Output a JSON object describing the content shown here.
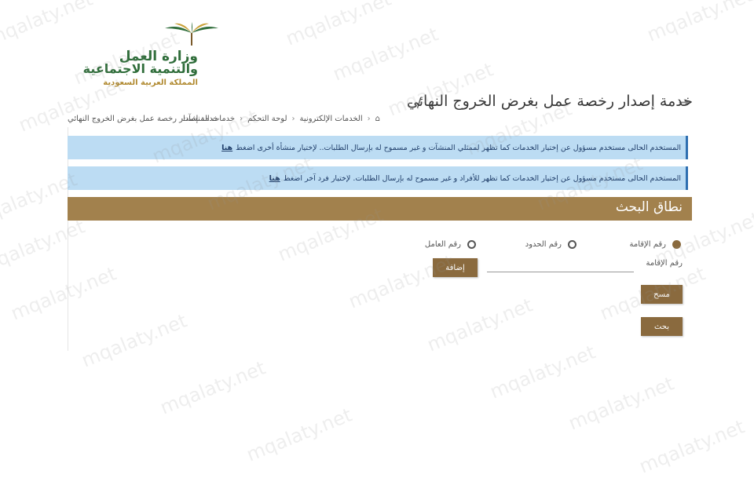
{
  "logo": {
    "line1": "وزارة العمل",
    "line2": "والتنمية الاجتماعية",
    "line3": "المملكة العربية السعودية"
  },
  "page": {
    "title": "خدمة إصدار رخصة عمل بغرض الخروج النهائي",
    "title_suffix": "/  -"
  },
  "breadcrumb": {
    "items": [
      "الخدمات الإلكترونية",
      "لوحة التحكم",
      "خدمات المنشآت",
      "خدمة إصدار رخصة عمل بغرض الخروج النهائي"
    ]
  },
  "alerts": [
    {
      "text": "المستخدم الحالى مستخدم مسؤول عن إختيار الخدمات كما تظهر لممثلي المنشآت و غير مسموح له بإرسال الطلبات.. لإختيار منشأة أخرى اضغط",
      "link": "هنا"
    },
    {
      "text": "المستخدم الحالى مستخدم مسؤول عن إختيار الخدمات كما تظهر للأفراد و غير مسموح له بإرسال الطلبات. لإختيار فرد آخر اضغط",
      "link": "هنا"
    }
  ],
  "search_section": {
    "title": "نطاق البحث",
    "options": [
      {
        "label": "رقم الإقامة",
        "selected": true
      },
      {
        "label": "رقم الحدود",
        "selected": false
      },
      {
        "label": "رقم العامل",
        "selected": false
      }
    ],
    "field_label": "رقم الإقامة",
    "field_value": "",
    "add_button": "إضافة",
    "clear_button": "مسح",
    "search_button": "بحث"
  },
  "watermark": "mqalaty.net",
  "colors": {
    "accent": "#8a6a3e",
    "header": "#a2814d",
    "alert_bg": "#bcdcf3"
  }
}
